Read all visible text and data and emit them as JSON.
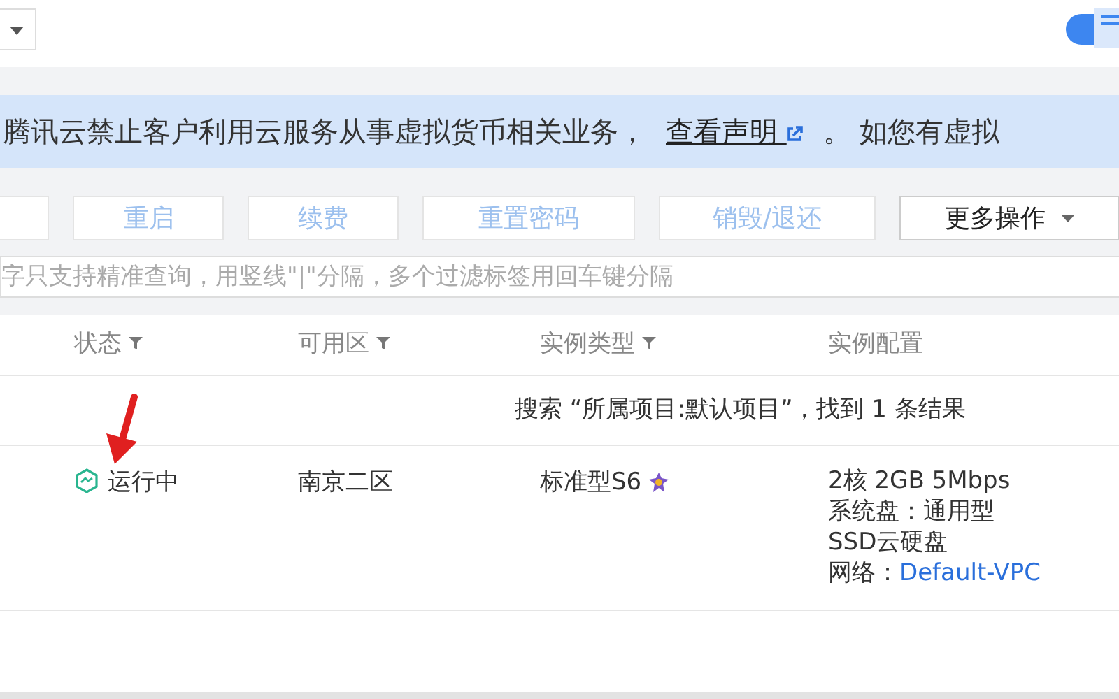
{
  "notice": {
    "text": "腾讯云禁止客户利用云服务从事虚拟货币相关业务，",
    "link": "查看声明",
    "tail": "。 如您有虚拟"
  },
  "toolbar": {
    "buttons": [
      {
        "disabled": true
      },
      {
        "label": "重启",
        "disabled": true
      },
      {
        "label": "续费",
        "disabled": true
      },
      {
        "label": "重置密码",
        "disabled": true
      },
      {
        "label": "销毁/退还",
        "disabled": true
      },
      {
        "label": "更多操作",
        "disabled": false,
        "dropdown": true
      }
    ]
  },
  "search": {
    "placeholder": "字只支持精准查询，用竖线\"|\"分隔，多个过滤标签用回车键分隔"
  },
  "table": {
    "columns": [
      {
        "label": "状态",
        "filter": true
      },
      {
        "label": "可用区",
        "filter": true
      },
      {
        "label": "实例类型",
        "filter": true
      },
      {
        "label": "实例配置",
        "filter": false
      }
    ],
    "result": "搜索 “所属项目:默认项目”，找到 1 条结果",
    "rows": [
      {
        "status": "运行中",
        "zone": "南京二区",
        "type": "标准型S6",
        "config": [
          "2核 2GB 5Mbps",
          "系统盘：通用型",
          "SSD云硬盘"
        ],
        "network_label": "网络：",
        "network": "Default-VPC"
      }
    ]
  }
}
